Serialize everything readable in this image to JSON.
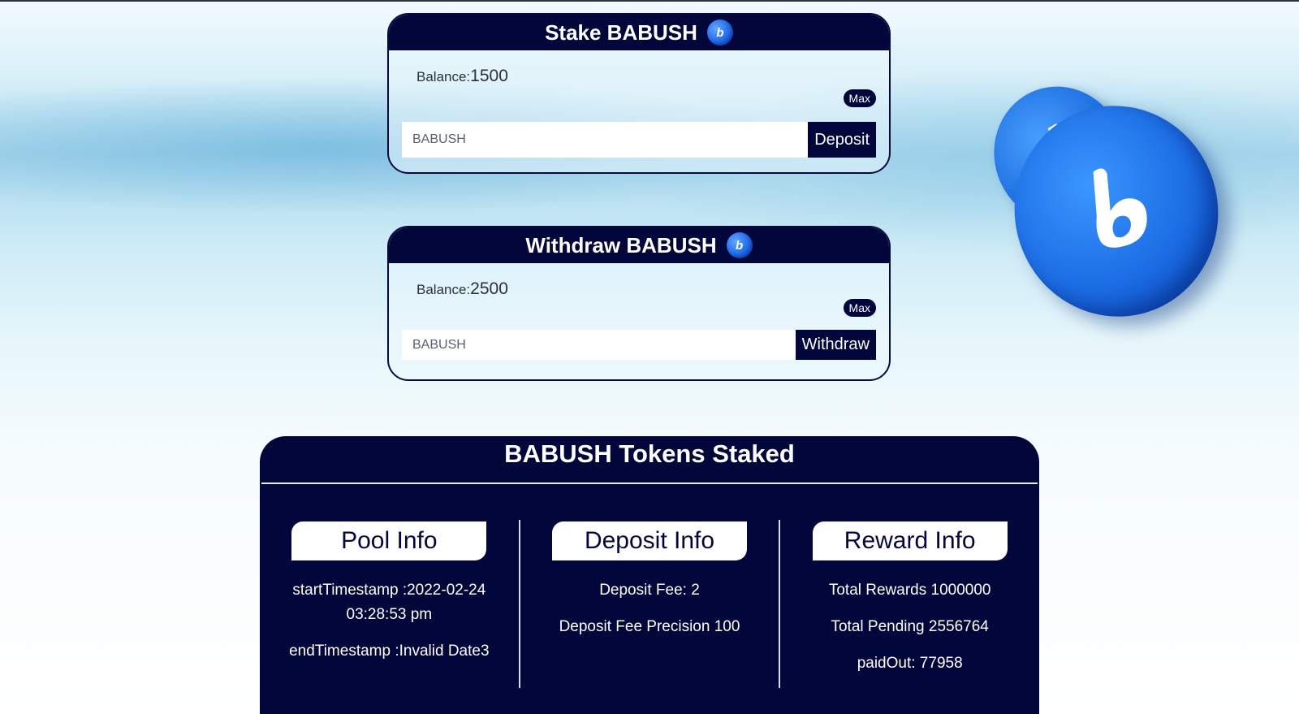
{
  "stake": {
    "title": "Stake BABUSH",
    "coin_icon": "babush-coin-icon",
    "balance_label": "Balance:",
    "balance_value": "1500",
    "max_label": "Max",
    "input_placeholder": "BABUSH",
    "action_label": "Deposit"
  },
  "withdraw": {
    "title": "Withdraw BABUSH",
    "coin_icon": "babush-coin-icon",
    "balance_label": "Balance:",
    "balance_value": "2500",
    "max_label": "Max",
    "input_placeholder": "BABUSH",
    "action_label": "Withdraw"
  },
  "staked": {
    "title": "BABUSH Tokens Staked",
    "pool": {
      "heading": "Pool Info",
      "start": "startTimestamp :2022-02-24 03:28:53 pm",
      "end": "endTimestamp :Invalid Date3"
    },
    "deposit": {
      "heading": "Deposit Info",
      "fee": "Deposit Fee: 2",
      "precision": "Deposit Fee Precision 100"
    },
    "reward": {
      "heading": "Reward Info",
      "total": "Total Rewards 1000000",
      "pending": "Total Pending 2556764",
      "paid": "paidOut: 77958"
    }
  },
  "colors": {
    "navy": "#02063a",
    "coin_blue": "#1c6de4"
  }
}
